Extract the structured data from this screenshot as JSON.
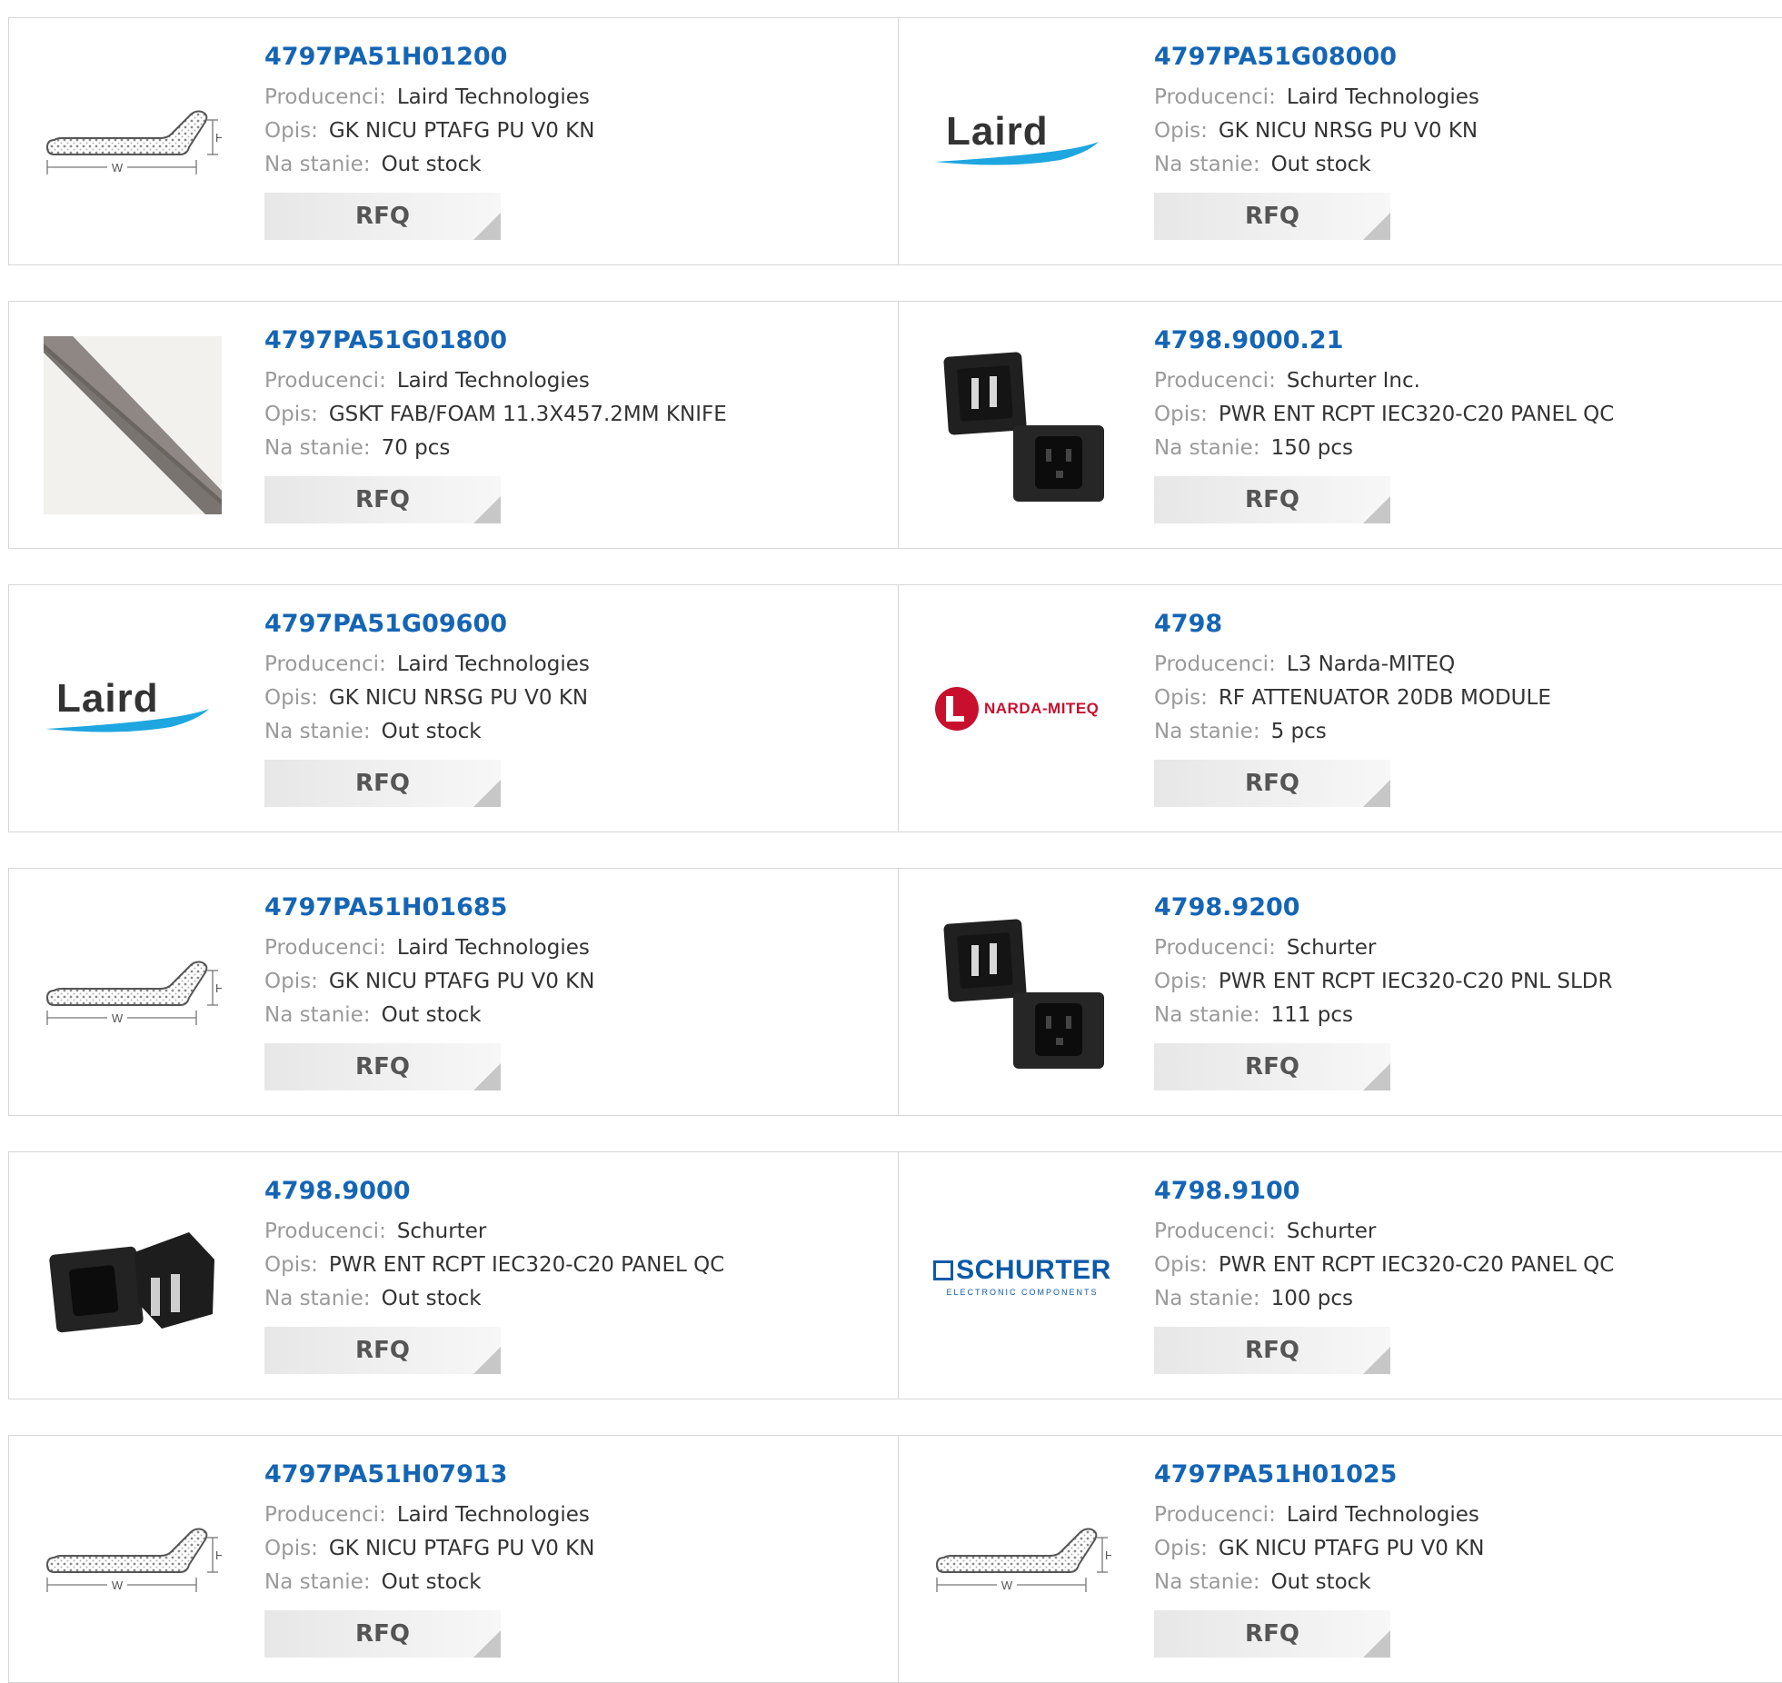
{
  "labels": {
    "manufacturer": "Producenci:",
    "description": "Opis:",
    "stock": "Na stanie:",
    "rfq": "RFQ"
  },
  "colors": {
    "link": "#1565b5",
    "label": "#9a9a9a",
    "value": "#333333",
    "border": "#d6d6d6",
    "button_bg": "#eeeeee"
  },
  "rows": [
    [
      {
        "part": "4797PA51H01200",
        "manufacturer": "Laird Technologies",
        "description": "GK NICU PTAFG PU V0 KN",
        "stock": "Out stock",
        "image": "gasket-profile-drawing"
      },
      {
        "part": "4797PA51G08000",
        "manufacturer": "Laird Technologies",
        "description": "GK NICU NRSG PU V0 KN",
        "stock": "Out stock",
        "image": "laird-logo",
        "logo_text": "Laird"
      }
    ],
    [
      {
        "part": "4797PA51G01800",
        "manufacturer": "Laird Technologies",
        "description": "GSKT FAB/FOAM 11.3X457.2MM KNIFE",
        "stock": "70 pcs",
        "image": "gasket-strip-photo"
      },
      {
        "part": "4798.9000.21",
        "manufacturer": "Schurter Inc.",
        "description": "PWR ENT RCPT IEC320-C20 PANEL QC",
        "stock": "150 pcs",
        "image": "iec-connector-pair"
      }
    ],
    [
      {
        "part": "4797PA51G09600",
        "manufacturer": "Laird Technologies",
        "description": "GK NICU NRSG PU V0 KN",
        "stock": "Out stock",
        "image": "laird-logo",
        "logo_text": "Laird"
      },
      {
        "part": "4798",
        "manufacturer": "L3 Narda-MITEQ",
        "description": "RF ATTENUATOR 20DB MODULE",
        "stock": "5 pcs",
        "image": "narda-miteq-logo",
        "logo_text": "NARDA-MITEQ"
      }
    ],
    [
      {
        "part": "4797PA51H01685",
        "manufacturer": "Laird Technologies",
        "description": "GK NICU PTAFG PU V0 KN",
        "stock": "Out stock",
        "image": "gasket-profile-drawing"
      },
      {
        "part": "4798.9200",
        "manufacturer": "Schurter",
        "description": "PWR ENT RCPT IEC320-C20 PNL SLDR",
        "stock": "111 pcs",
        "image": "iec-connector-pair"
      }
    ],
    [
      {
        "part": "4798.9000",
        "manufacturer": "Schurter",
        "description": "PWR ENT RCPT IEC320-C20 PANEL QC",
        "stock": "Out stock",
        "image": "iec-connector-side"
      },
      {
        "part": "4798.9100",
        "manufacturer": "Schurter",
        "description": "PWR ENT RCPT IEC320-C20 PANEL QC",
        "stock": "100 pcs",
        "image": "schurter-logo",
        "logo_text": "SCHURTER",
        "logo_subtext": "ELECTRONIC COMPONENTS"
      }
    ],
    [
      {
        "part": "4797PA51H07913",
        "manufacturer": "Laird Technologies",
        "description": "GK NICU PTAFG PU V0 KN",
        "stock": "Out stock",
        "image": "gasket-profile-drawing"
      },
      {
        "part": "4797PA51H01025",
        "manufacturer": "Laird Technologies",
        "description": "GK NICU PTAFG PU V0 KN",
        "stock": "Out stock",
        "image": "gasket-profile-drawing"
      }
    ]
  ]
}
